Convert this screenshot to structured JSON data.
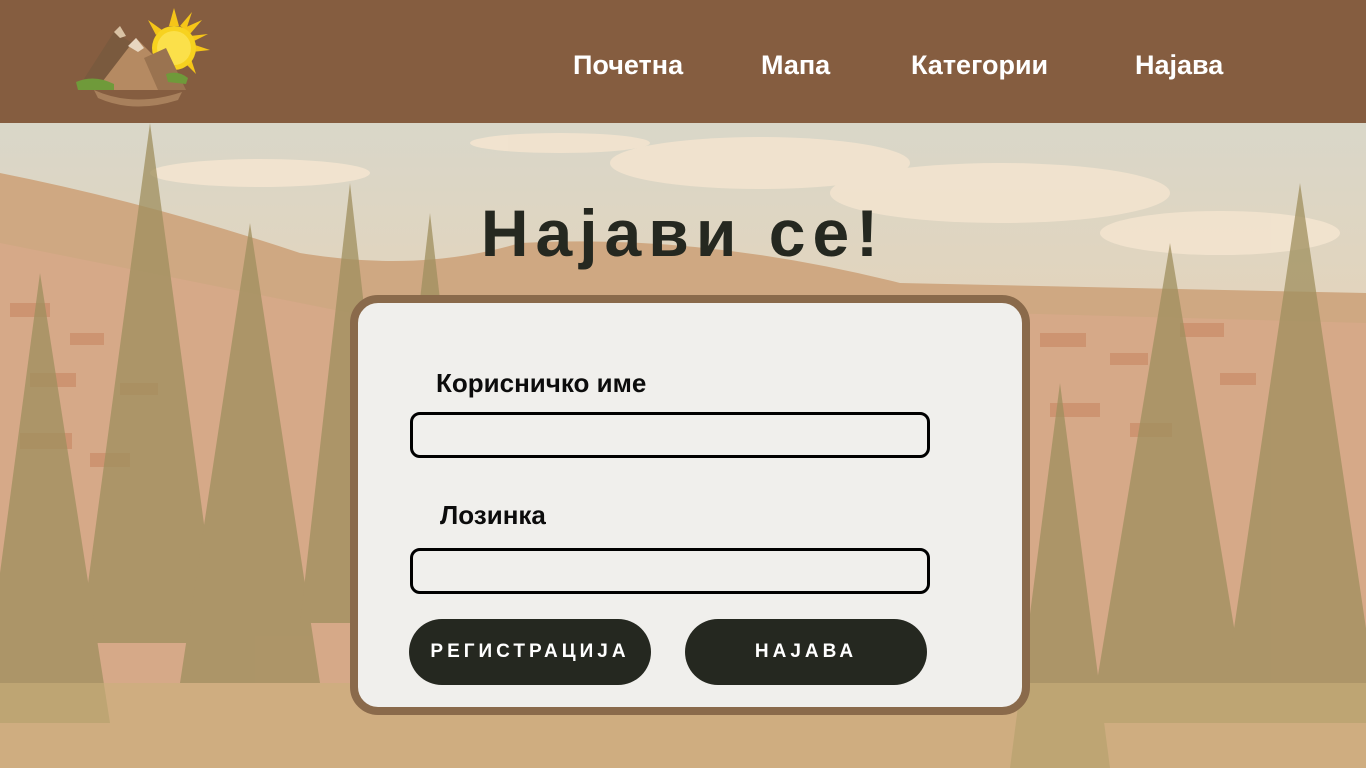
{
  "nav": {
    "home": "Почетна",
    "map": "Мапа",
    "categories": "Категории",
    "login": "Најава"
  },
  "logo_icon": "mountain-sun-logo",
  "heading": "Најави се!",
  "form": {
    "username_label": "Корисничко име",
    "username_value": "",
    "password_label": "Лозинка",
    "password_value": "",
    "register_button": "РЕГИСТРАЦИЈА",
    "login_button": "НАЈАВА"
  },
  "colors": {
    "header": "#855d40",
    "card_border": "#8a6a4b",
    "card_bg": "#f0efec",
    "button_bg": "#252820",
    "heading": "#252820"
  }
}
